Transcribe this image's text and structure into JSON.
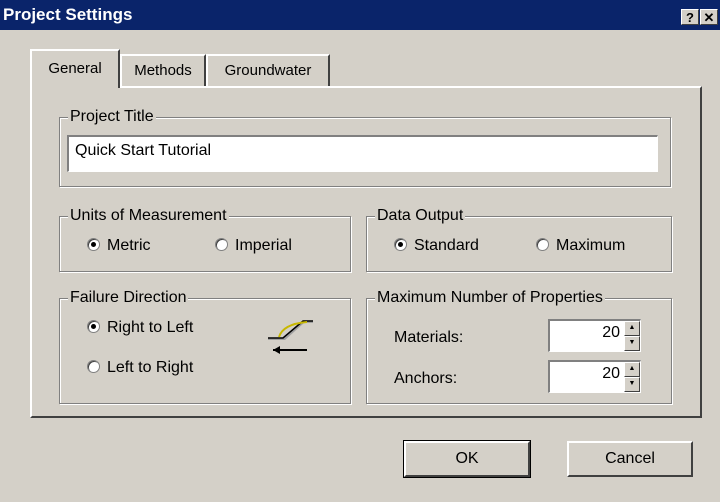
{
  "dialog": {
    "title": "Project Settings",
    "help_label": "?",
    "close_label": "✕"
  },
  "tabs": [
    {
      "label": "General",
      "active": true
    },
    {
      "label": "Methods",
      "active": false
    },
    {
      "label": "Groundwater",
      "active": false
    }
  ],
  "project_title": {
    "legend": "Project Title",
    "value": "Quick Start Tutorial"
  },
  "units": {
    "legend": "Units of Measurement",
    "options": [
      {
        "label": "Metric",
        "selected": true
      },
      {
        "label": "Imperial",
        "selected": false
      }
    ]
  },
  "data_output": {
    "legend": "Data Output",
    "options": [
      {
        "label": "Standard",
        "selected": true
      },
      {
        "label": "Maximum",
        "selected": false
      }
    ]
  },
  "failure_direction": {
    "legend": "Failure Direction",
    "options": [
      {
        "label": "Right to Left",
        "selected": true
      },
      {
        "label": "Left to Right",
        "selected": false
      }
    ],
    "icon": "slope-failure-left-icon"
  },
  "max_properties": {
    "legend": "Maximum Number of Properties",
    "materials_label": "Materials:",
    "materials_value": "20",
    "anchors_label": "Anchors:",
    "anchors_value": "20"
  },
  "buttons": {
    "ok": "OK",
    "cancel": "Cancel"
  }
}
